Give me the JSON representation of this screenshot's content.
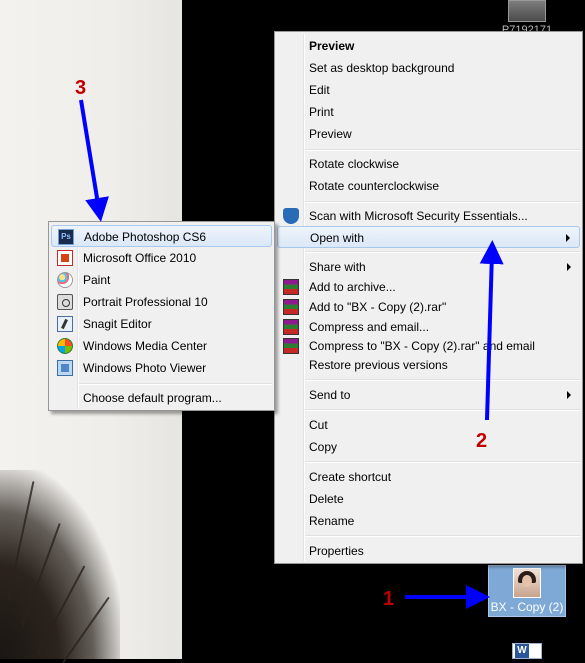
{
  "desktop": {
    "top_icon_label": "P7192171",
    "selected_icon_label": "BX - Copy (2)"
  },
  "context_menu": {
    "items": [
      {
        "label": "Preview",
        "bold": true
      },
      {
        "label": "Set as desktop background"
      },
      {
        "label": "Edit"
      },
      {
        "label": "Print"
      },
      {
        "label": "Preview"
      },
      {
        "label": "Rotate clockwise"
      },
      {
        "label": "Rotate counterclockwise"
      },
      {
        "label": "Scan with Microsoft Security Essentials...",
        "icon": "shield-icon"
      },
      {
        "label": "Open with",
        "submenu": true
      },
      {
        "label": "Share with",
        "submenu": true
      },
      {
        "label": "Add to archive...",
        "icon": "winrar-icon"
      },
      {
        "label": "Add to \"BX - Copy (2).rar\"",
        "icon": "winrar-icon"
      },
      {
        "label": "Compress and email...",
        "icon": "winrar-icon"
      },
      {
        "label": "Compress to \"BX - Copy (2).rar\" and email",
        "icon": "winrar-icon"
      },
      {
        "label": "Restore previous versions"
      },
      {
        "label": "Send to",
        "submenu": true
      },
      {
        "label": "Cut"
      },
      {
        "label": "Copy"
      },
      {
        "label": "Create shortcut"
      },
      {
        "label": "Delete"
      },
      {
        "label": "Rename"
      },
      {
        "label": "Properties"
      }
    ]
  },
  "open_with_menu": {
    "items": [
      {
        "label": "Adobe Photoshop CS6",
        "icon": "photoshop-icon",
        "icon_text": "Ps"
      },
      {
        "label": "Microsoft Office 2010",
        "icon": "office-icon"
      },
      {
        "label": "Paint",
        "icon": "paint-icon"
      },
      {
        "label": "Portrait Professional 10",
        "icon": "camera-icon"
      },
      {
        "label": "Snagit Editor",
        "icon": "snagit-icon"
      },
      {
        "label": "Windows Media Center",
        "icon": "media-center-icon"
      },
      {
        "label": "Windows Photo Viewer",
        "icon": "photo-viewer-icon"
      },
      {
        "label": "Choose default program..."
      }
    ]
  },
  "annotations": {
    "step1": "1",
    "step2": "2",
    "step3": "3",
    "arrow_color": "#0000ff",
    "number_color": "#c00000"
  }
}
